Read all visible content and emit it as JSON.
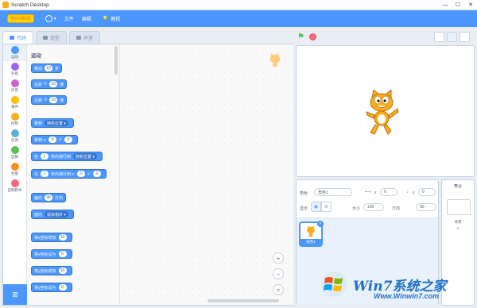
{
  "window": {
    "title": "Scratch Desktop",
    "minimize": "—",
    "maximize": "☐",
    "close": "✕"
  },
  "menubar": {
    "logo": "Scratch",
    "file": "文件",
    "edit": "编辑",
    "tutorials": "教程"
  },
  "tabs": [
    {
      "label": "代码"
    },
    {
      "label": "造型"
    },
    {
      "label": "声音"
    }
  ],
  "categories": [
    {
      "label": "运动",
      "color": "#4c97ff"
    },
    {
      "label": "外观",
      "color": "#9966ff"
    },
    {
      "label": "声音",
      "color": "#cf63cf"
    },
    {
      "label": "事件",
      "color": "#ffbf00"
    },
    {
      "label": "控制",
      "color": "#ffab19"
    },
    {
      "label": "侦测",
      "color": "#5cb1d6"
    },
    {
      "label": "运算",
      "color": "#59c059"
    },
    {
      "label": "变量",
      "color": "#ff8c1a"
    },
    {
      "label": "自制积木",
      "color": "#ff6680"
    }
  ],
  "palette": {
    "heading": "运动",
    "blocks": {
      "move": {
        "pre": "移动",
        "val": "10",
        "post": "步"
      },
      "turn_right": {
        "pre": "右转",
        "icon": "↻",
        "val": "15",
        "post": "度"
      },
      "turn_left": {
        "pre": "左转",
        "icon": "↺",
        "val": "15",
        "post": "度"
      },
      "goto": {
        "pre": "移到",
        "dd": "随机位置 ▾"
      },
      "goto_xy": {
        "pre": "移到 x:",
        "x": "0",
        "mid": "y:",
        "y": "0"
      },
      "glide": {
        "pre": "在",
        "val": "1",
        "mid": "秒内滑行到",
        "dd": "随机位置 ▾"
      },
      "glide_xy": {
        "pre": "在",
        "val": "1",
        "mid": "秒内滑行到 x:",
        "x": "0",
        "mid2": "y:",
        "y": "0"
      },
      "point_dir": {
        "pre": "面向",
        "val": "90",
        "post": "方向"
      },
      "point_towards": {
        "pre": "面向",
        "dd": "鼠标指针 ▾"
      },
      "change_x": {
        "pre": "将x坐标增加",
        "val": "10"
      },
      "set_x": {
        "pre": "将x坐标设为",
        "val": "0"
      },
      "change_y": {
        "pre": "将y坐标增加",
        "val": "10"
      },
      "set_y": {
        "pre": "将y坐标设为",
        "val": "0"
      }
    }
  },
  "zoom": {
    "in": "+",
    "out": "−",
    "reset": "="
  },
  "sprite_info": {
    "sprite_label": "角色",
    "sprite_name": "角色1",
    "x_label": "x",
    "x_value": "0",
    "y_label": "y",
    "y_value": "0",
    "show_label": "显示",
    "size_label": "大小",
    "size_value": "100",
    "direction_label": "方向",
    "direction_value": "90"
  },
  "sprites": [
    {
      "name": "角色1"
    }
  ],
  "stage_panel": {
    "title": "舞台",
    "backdrops_label": "背景",
    "backdrops_count": "1"
  },
  "watermark": {
    "text": "Win7系统之家",
    "url": "Www.Winwin7.com"
  }
}
